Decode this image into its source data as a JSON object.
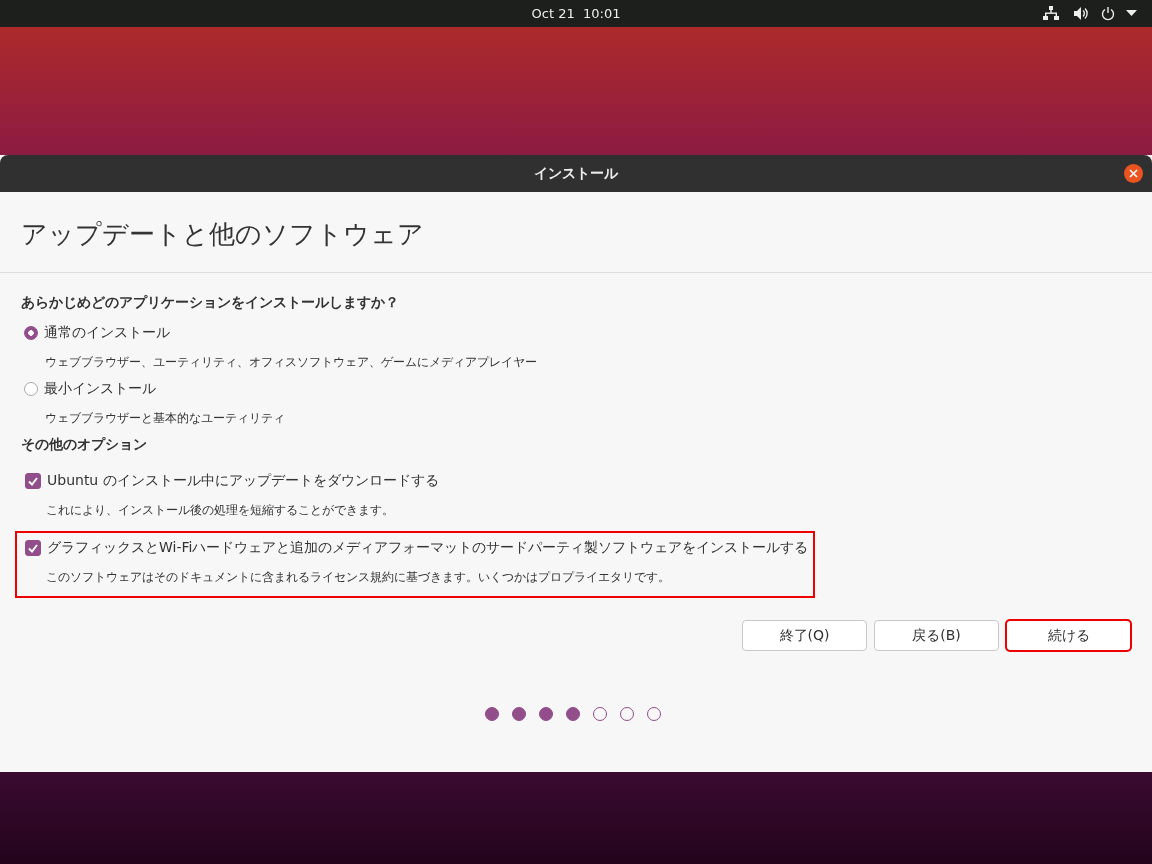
{
  "top_bar": {
    "clock": "Oct 21  10:01"
  },
  "window": {
    "title": "インストール"
  },
  "page_title": "アップデートと他のソフトウェア",
  "install_question": "あらかじめどのアプリケーションをインストールしますか？",
  "install_types": [
    {
      "label": "通常のインストール",
      "description": "ウェブブラウザー、ユーティリティ、オフィスソフトウェア、ゲームにメディアプレイヤー",
      "selected": true
    },
    {
      "label": "最小インストール",
      "description": "ウェブブラウザーと基本的なユーティリティ",
      "selected": false
    }
  ],
  "other_options_heading": "その他のオプション",
  "other_options": [
    {
      "label": "Ubuntu のインストール中にアップデートをダウンロードする",
      "description": "これにより、インストール後の処理を短縮することができます。",
      "checked": true,
      "highlighted": false
    },
    {
      "label": "グラフィックスとWi-Fiハードウェアと追加のメディアフォーマットのサードパーティ製ソフトウェアをインストールする",
      "description": "このソフトウェアはそのドキュメントに含まれるライセンス規約に基づきます。いくつかはプロプライエタリです。",
      "checked": true,
      "highlighted": true
    }
  ],
  "buttons": [
    {
      "label": "終了(Q)",
      "highlighted": false
    },
    {
      "label": "戻る(B)",
      "highlighted": false
    },
    {
      "label": "続ける",
      "highlighted": true
    }
  ],
  "progress_steps": [
    {
      "done": true
    },
    {
      "done": true
    },
    {
      "done": true
    },
    {
      "done": true
    },
    {
      "done": false
    },
    {
      "done": false
    },
    {
      "done": false
    }
  ]
}
